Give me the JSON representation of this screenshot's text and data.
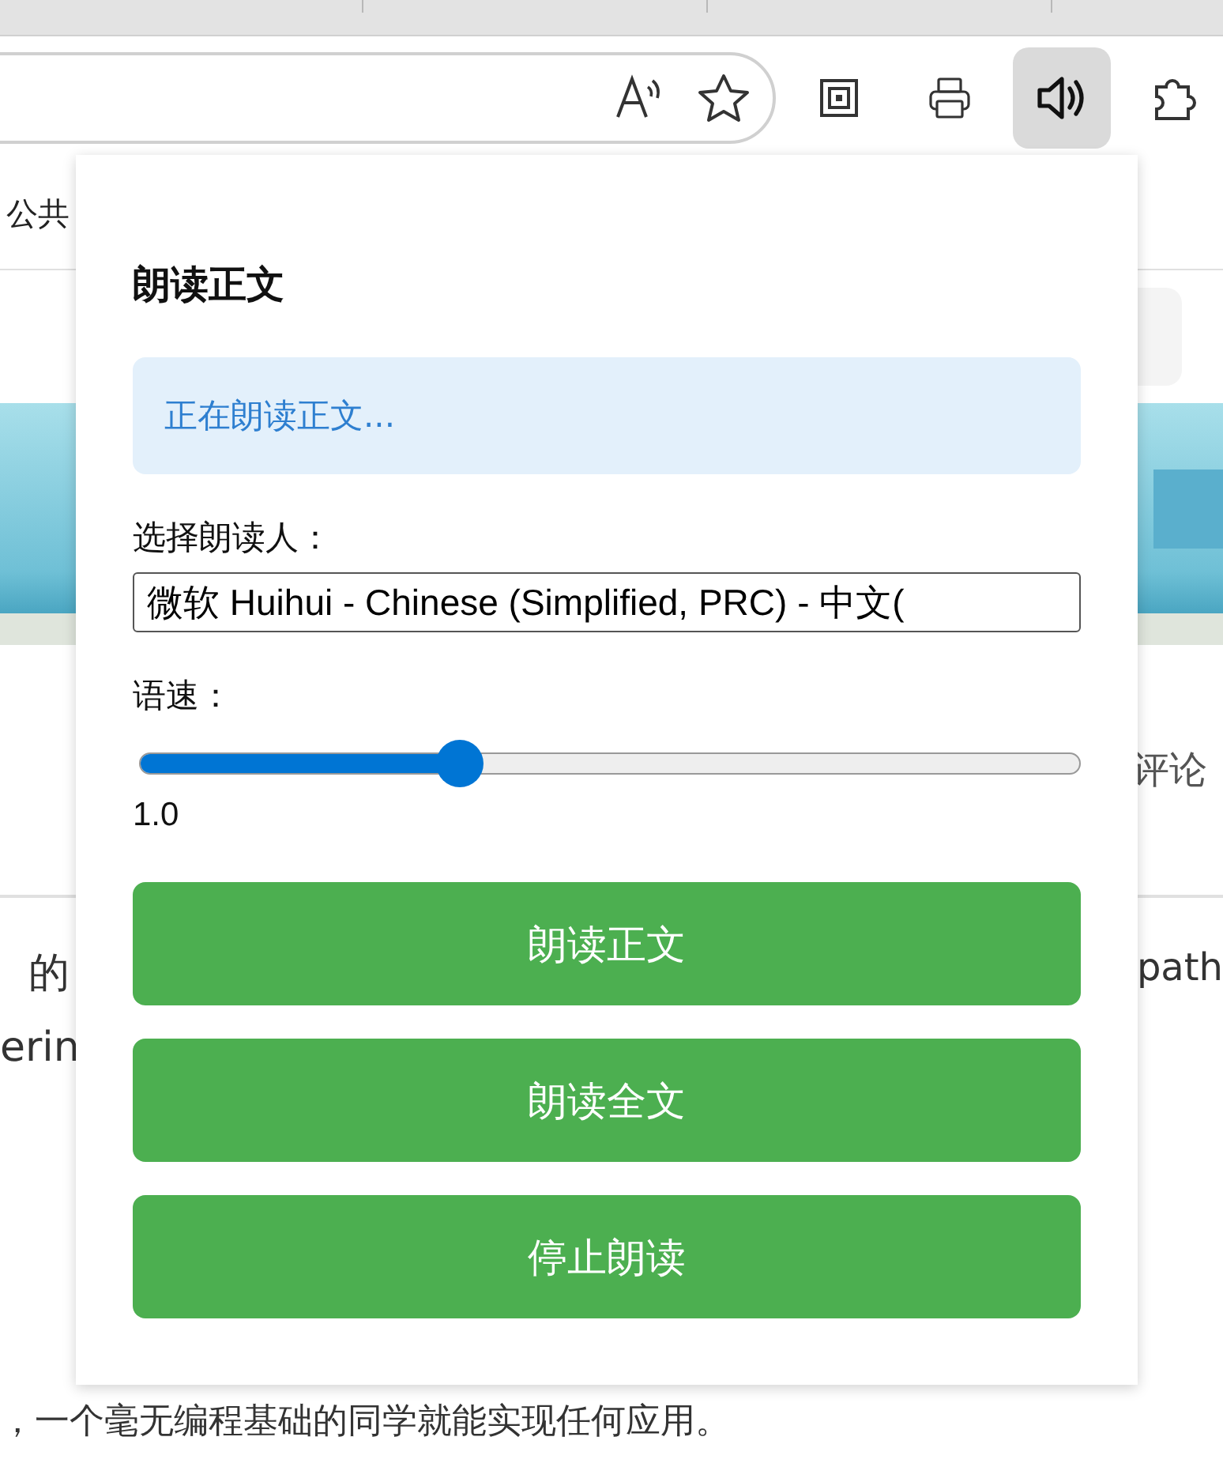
{
  "toolbar": {
    "buttons": [
      {
        "kind": "collections",
        "active": false
      },
      {
        "kind": "pdf",
        "active": false
      },
      {
        "kind": "speaker",
        "active": true
      },
      {
        "kind": "extensions",
        "active": false
      }
    ]
  },
  "bookmarks_bar": {
    "items": [
      "公共"
    ]
  },
  "page": {
    "right_label": "评论",
    "text_fragments": [
      {
        "kind": "left",
        "text": "的"
      },
      {
        "kind": "right",
        "text": "path"
      },
      {
        "kind": "left",
        "text": "erin"
      }
    ],
    "bottom_text": "，一个毫无编程基础的同学就能实现任何应用。"
  },
  "popup": {
    "title": "朗读正文",
    "status": "正在朗读正文...",
    "voice_label": "选择朗读人：",
    "voice_value": "微软 Huihui - Chinese (Simplified, PRC) - 中文(",
    "speed_label": "语速：",
    "speed": {
      "level": 0.34,
      "reading": "1.0"
    },
    "buttons": [
      "朗读正文",
      "朗读全文",
      "停止朗读"
    ]
  }
}
